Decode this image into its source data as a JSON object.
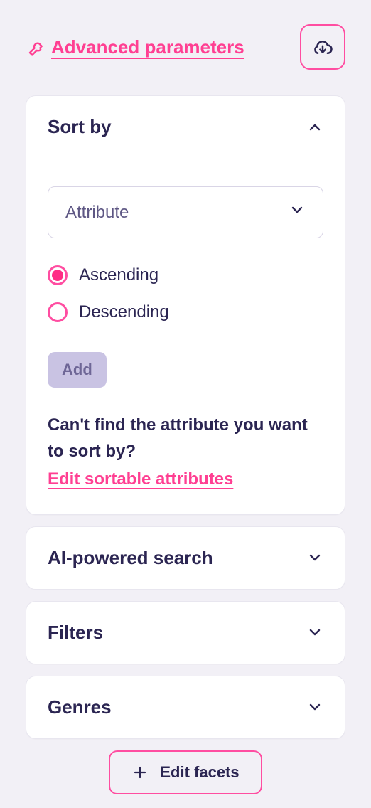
{
  "header": {
    "advanced_label": "Advanced parameters"
  },
  "sort": {
    "title": "Sort by",
    "expanded": true,
    "attribute_placeholder": "Attribute",
    "order": {
      "asc": "Ascending",
      "desc": "Descending",
      "selected": "asc"
    },
    "add_label": "Add",
    "helper_text": "Can't find the attribute you want to sort by?",
    "helper_link": "Edit sortable attributes"
  },
  "sections": {
    "ai": "AI-powered search",
    "filters": "Filters",
    "genres": "Genres"
  },
  "footer": {
    "edit_facets": "Edit facets"
  },
  "colors": {
    "accent": "#ff3f92",
    "text": "#2b2552",
    "bg": "#f2f0f6"
  }
}
